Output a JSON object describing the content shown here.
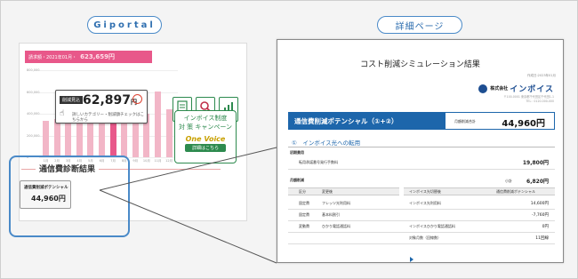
{
  "labels": {
    "left_pill": "Giportal",
    "right_pill": "詳細ページ"
  },
  "mockup": {
    "top_bar_label": "請求額・2021年01月・",
    "top_bar_amount": "623,659円",
    "y_labels": [
      "800,000",
      "600,000",
      "400,000",
      "200,000",
      "0"
    ],
    "x_labels": [
      "1月",
      "2月",
      "3月",
      "4月",
      "5月",
      "6月",
      "7月",
      "8月",
      "9月",
      "10月",
      "11月",
      "12月"
    ],
    "bar_values": [
      0.42,
      0.44,
      0.4,
      0.46,
      0.48,
      0.62,
      0.7,
      0.58,
      0.52,
      0.5,
      0.76,
      0.55
    ],
    "callout": {
      "tag": "削減見込",
      "amount": "62,897",
      "yen": "円",
      "note": "詳しいカテゴリー・削減額チェックはこちらから"
    },
    "buttons": [
      {
        "label": "請求書"
      },
      {
        "label": "明細"
      },
      {
        "label": "分析"
      }
    ],
    "banner": {
      "l1": "インボイス制度",
      "l2": "対 策 キャンペーン",
      "brand": "One Voice",
      "tag": "詳細はこちら"
    },
    "diag_title": "通信費診断結果",
    "diag_card_label": "通信費削減ポテンシャル",
    "diag_card_amount": "44,960円"
  },
  "panel": {
    "title": "コスト削減シミュレーション結果",
    "date": "作成日:2023年01月",
    "company_small": "株式会社",
    "company_big": "インボイス",
    "address": [
      "〒100-0001 東京都千代田区千代田1-1",
      "TEL：0120-000-000"
    ],
    "header_label": "通信費削減ポテンシャル（①+②）",
    "header_mid": "月額削減合計",
    "header_value": "44,960円",
    "section1": "①　インボイス光への転用",
    "initial_cost_label": "初期費用",
    "initial_item": "転用承諾番号発行手数料",
    "initial_value": "19,800円",
    "monthly_label": "月額削減",
    "subtotal_label": "小計",
    "subtotal_value": "6,820円",
    "table_head": [
      "区分",
      "変更後",
      "インボイス光切替後",
      "通信費削減ポテンシャル"
    ],
    "rows": [
      {
        "cat": "固定費",
        "item": "フレッツ光利用料",
        "after": "インボイス光利用料",
        "value": "14,600円"
      },
      {
        "cat": "固定費",
        "item": "基本料割引",
        "after": "",
        "value": "-7,760円"
      },
      {
        "cat": "変動費",
        "item": "ひかり電話通話料",
        "after": "インボイスひかり電話通話料",
        "value": "0円"
      },
      {
        "cat": "",
        "item": "",
        "after": "対象月数（回線数）",
        "value": "11回線"
      }
    ]
  }
}
